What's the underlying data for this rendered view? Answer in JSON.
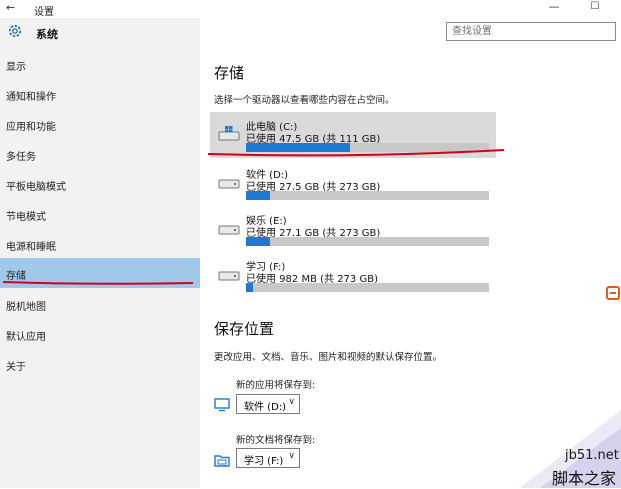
{
  "window": {
    "back_glyph": "←",
    "title": "设置",
    "minimize_glyph": "—",
    "maximize_glyph": "☐"
  },
  "sidebar": {
    "section_title": "系统",
    "items": [
      {
        "label": "显示"
      },
      {
        "label": "通知和操作"
      },
      {
        "label": "应用和功能"
      },
      {
        "label": "多任务"
      },
      {
        "label": "平板电脑模式"
      },
      {
        "label": "节电模式"
      },
      {
        "label": "电源和睡眠"
      },
      {
        "label": "存储",
        "selected": true
      },
      {
        "label": "脱机地图"
      },
      {
        "label": "默认应用"
      },
      {
        "label": "关于"
      }
    ]
  },
  "search": {
    "placeholder": "查找设置"
  },
  "storage": {
    "heading": "存储",
    "description": "选择一个驱动器以查看哪些内容在占空间。",
    "drives": [
      {
        "name": "此电脑 (C:)",
        "usage": "已使用 47.5 GB (共 111 GB)",
        "used_fraction": 0.43,
        "icon": "windows-drive-icon"
      },
      {
        "name": "软件 (D:)",
        "usage": "已使用 27.5 GB (共 273 GB)",
        "used_fraction": 0.1,
        "icon": "drive-icon"
      },
      {
        "name": "娱乐 (E:)",
        "usage": "已使用 27.1 GB (共 273 GB)",
        "used_fraction": 0.1,
        "icon": "drive-icon"
      },
      {
        "name": "学习 (F:)",
        "usage": "已使用 982 MB (共 273 GB)",
        "used_fraction": 0.004,
        "icon": "drive-icon"
      }
    ]
  },
  "save_locations": {
    "heading": "保存位置",
    "description": "更改应用、文档、音乐、图片和视频的默认保存位置。",
    "rows": [
      {
        "label": "新的应用将保存到:",
        "selected": "软件 (D:)",
        "icon": "monitor-icon"
      },
      {
        "label": "新的文档将保存到:",
        "selected": "学习 (F:)",
        "icon": "folder-icon"
      }
    ]
  },
  "watermark": {
    "domain": "jb51.net",
    "name": "脚本之家"
  },
  "colors": {
    "accent": "#1f78d1",
    "selected_bg": "#9fc8ea",
    "annotation_red": "#d0021b"
  }
}
